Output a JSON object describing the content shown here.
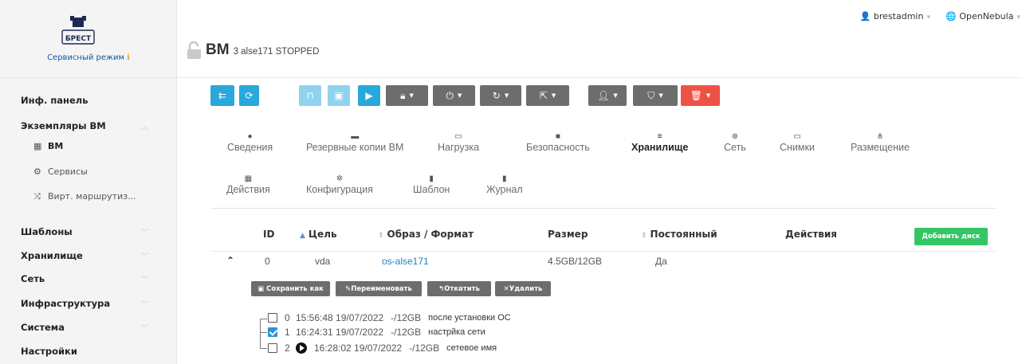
{
  "brand": {
    "logo_text": "БРЕСТ",
    "mode_label": "Сервисный режим",
    "mode_icon": "info-icon"
  },
  "sidebar": {
    "dashboard": "Инф. панель",
    "vm_instances": "Экземпляры ВМ",
    "vm_sub": [
      "ВМ",
      "Сервисы",
      "Вирт. маршрутиз..."
    ],
    "sections": [
      "Шаблоны",
      "Хранилище",
      "Сеть",
      "Инфраструктура",
      "Система",
      "Настройки"
    ]
  },
  "header": {
    "user": "brestadmin",
    "zone": "OpenNebula"
  },
  "vm": {
    "title": "ВМ",
    "subtitle": "3 alse171 STOPPED"
  },
  "tabs_row1": [
    "Сведения",
    "Резервные копии ВМ",
    "Нагрузка",
    "Безопасность",
    "Хранилище",
    "Сеть",
    "Снимки",
    "Размещение"
  ],
  "tabs_row2": [
    "Действия",
    "Конфигурация",
    "Шаблон",
    "Журнал"
  ],
  "active_tab": "Хранилище",
  "table": {
    "headers": [
      "ID",
      "Цель",
      "Образ / Формат",
      "Размер",
      "Постоянный",
      "Действия"
    ],
    "add_button": "Добавить диск",
    "row": {
      "id": "0",
      "target": "vda",
      "image": "os-alse171",
      "size": "4.5GB/12GB",
      "persistent": "Да"
    }
  },
  "snapshot_actions": [
    "Сохранить как",
    "Переименовать",
    "Откатить",
    "Удалить"
  ],
  "snapshots": [
    {
      "id": "0",
      "date": "15:56:48 19/07/2022",
      "size": "-/12GB",
      "name": "после установки ОС",
      "checked": false,
      "active": false
    },
    {
      "id": "1",
      "date": "16:24:31 19/07/2022",
      "size": "-/12GB",
      "name": "настрйка сети",
      "checked": true,
      "active": false
    },
    {
      "id": "2",
      "date": "16:28:02 19/07/2022",
      "size": "-/12GB",
      "name": "сетевое имя",
      "checked": false,
      "active": true
    }
  ],
  "colors": {
    "accent": "#29a9db",
    "danger": "#ee5245",
    "success": "#35c565",
    "link": "#1a86c6"
  }
}
